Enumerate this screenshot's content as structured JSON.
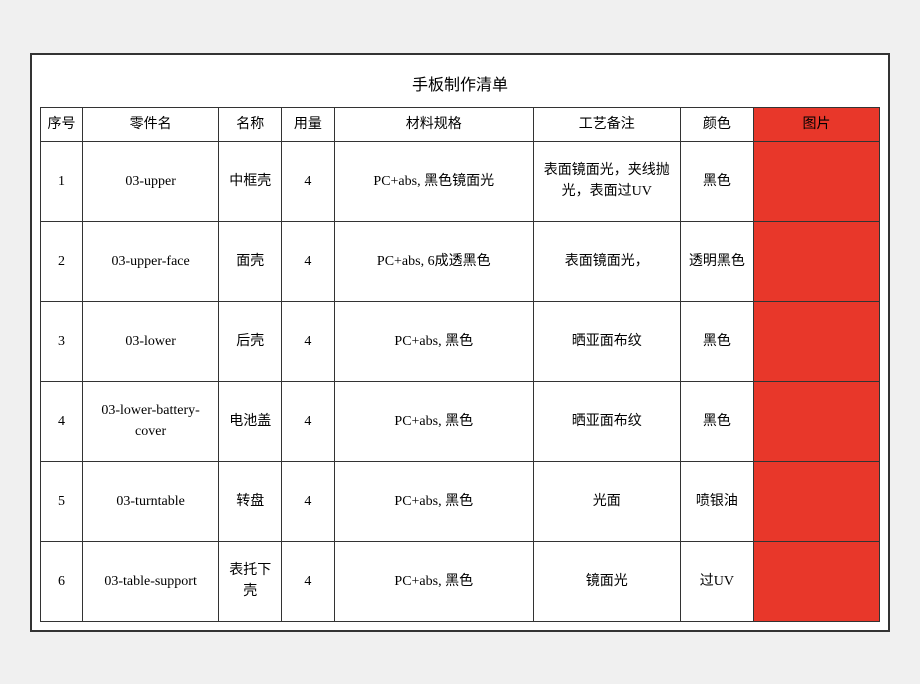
{
  "table": {
    "title": "手板制作清单",
    "headers": {
      "seq": "序号",
      "part_code": "零件名",
      "name": "名称",
      "qty": "用量",
      "spec": "材料规格",
      "process": "工艺备注",
      "color": "颜色",
      "image": "图片"
    },
    "rows": [
      {
        "seq": "1",
        "part_code": "03-upper",
        "name": "中框壳",
        "qty": "4",
        "spec": "PC+abs, 黑色镜面光",
        "process": "表面镜面光，夹线抛光，表面过UV",
        "color": "黑色",
        "image": ""
      },
      {
        "seq": "2",
        "part_code": "03-upper-face",
        "name": "面壳",
        "qty": "4",
        "spec": "PC+abs, 6成透黑色",
        "process": "表面镜面光，",
        "color": "透明黑色",
        "image": ""
      },
      {
        "seq": "3",
        "part_code": "03-lower",
        "name": "后壳",
        "qty": "4",
        "spec": "PC+abs, 黑色",
        "process": "晒亚面布纹",
        "color": "黑色",
        "image": ""
      },
      {
        "seq": "4",
        "part_code": "03-lower-battery-cover",
        "name": "电池盖",
        "qty": "4",
        "spec": "PC+abs, 黑色",
        "process": "晒亚面布纹",
        "color": "黑色",
        "image": ""
      },
      {
        "seq": "5",
        "part_code": "03-turntable",
        "name": "转盘",
        "qty": "4",
        "spec": "PC+abs, 黑色",
        "process": "光面",
        "color": "喷银油",
        "image": ""
      },
      {
        "seq": "6",
        "part_code": "03-table-support",
        "name": "表托下壳",
        "qty": "4",
        "spec": "PC+abs, 黑色",
        "process": "镜面光",
        "color": "过UV",
        "image": ""
      }
    ]
  }
}
